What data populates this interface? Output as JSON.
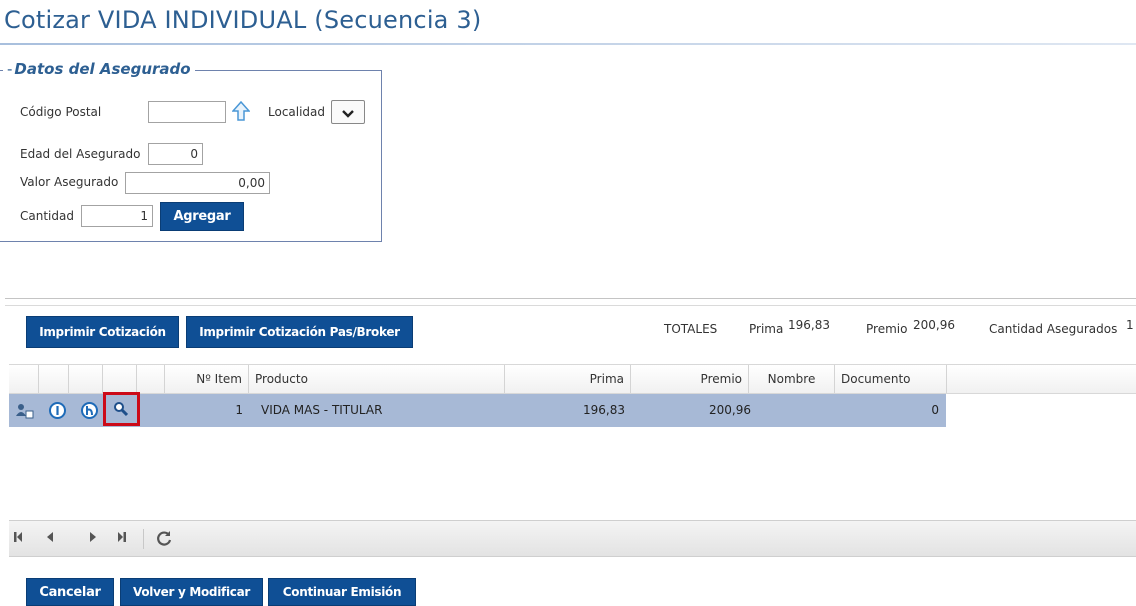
{
  "page": {
    "title": "Cotizar VIDA INDIVIDUAL (Secuencia 3)"
  },
  "asegurado": {
    "legend": "Datos del Asegurado",
    "codigo_postal_label": "Código Postal",
    "codigo_postal_value": "",
    "localidad_label": "Localidad",
    "localidad_value": "",
    "edad_label": "Edad del Asegurado",
    "edad_value": "0",
    "valor_label": "Valor Asegurado",
    "valor_value": "0,00",
    "cantidad_label": "Cantidad",
    "cantidad_value": "1",
    "agregar_button": "Agregar"
  },
  "toolbar": {
    "imprimir_label": "Imprimir Cotización",
    "imprimir_broker_label": "Imprimir Cotización Pas/Broker"
  },
  "totales": {
    "label": "TOTALES",
    "prima_label": "Prima",
    "prima_value": "196,83",
    "premio_label": "Premio",
    "premio_value": "200,96",
    "cantidad_label": "Cantidad Asegurados",
    "cantidad_value": "1"
  },
  "grid": {
    "columns": [
      "Nº Item",
      "Producto",
      "Prima",
      "Premio",
      "Nombre",
      "Documento"
    ],
    "rows": [
      {
        "item": "1",
        "producto": "VIDA MAS - TITULAR",
        "prima": "196,83",
        "premio": "200,96",
        "nombre": "",
        "documento": "0"
      }
    ]
  },
  "pager": {
    "icons": [
      "first-page-icon",
      "prev-page-icon",
      "next-page-icon",
      "last-page-icon",
      "refresh-icon"
    ]
  },
  "footer": {
    "cancelar_label": "Cancelar",
    "volver_label": "Volver y Modificar",
    "continuar_label": "Continuar Emisión"
  },
  "colors": {
    "title": "#2d5f92",
    "button": "#0f4f95",
    "selected_row": "#a7b9d6",
    "highlight": "#cc0a18"
  }
}
